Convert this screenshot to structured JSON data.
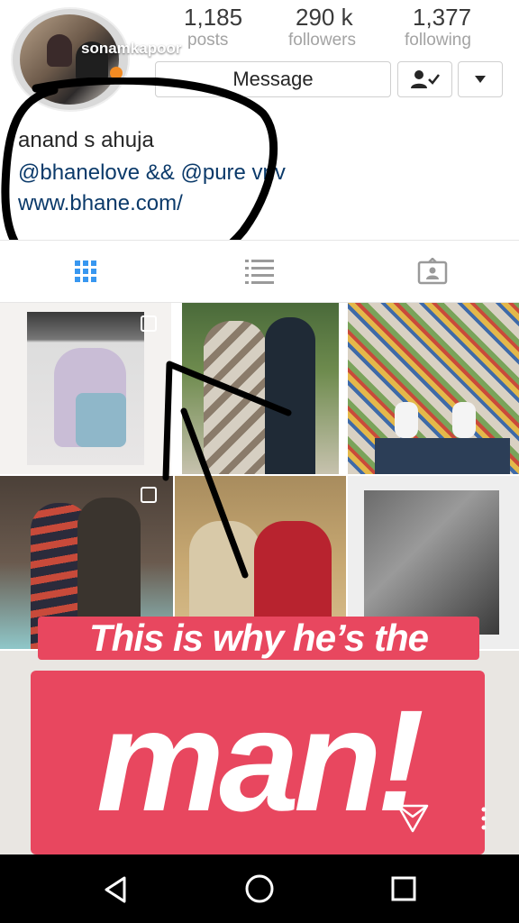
{
  "profile": {
    "username": "sonamkapoor",
    "stats": [
      {
        "value": "1,185",
        "label": "posts"
      },
      {
        "value": "290 k",
        "label": "followers"
      },
      {
        "value": "1,377",
        "label": "following"
      }
    ],
    "message_label": "Message",
    "bio": {
      "name": "anand s ahuja",
      "line": "@bhanelove && @pure vnv",
      "url": "www.bhane.com/"
    }
  },
  "sticker": {
    "line1": "This is why he’s the",
    "line2": "man!"
  },
  "icons": {
    "grid_tab": "grid-icon",
    "list_tab": "list-icon",
    "tagged_tab": "tagged-icon",
    "follow_button": "person-check-icon",
    "dropdown": "chevron-down-icon",
    "send": "send-icon",
    "more": "more-vertical-icon",
    "nav_back": "back-triangle-icon",
    "nav_home": "home-circle-icon",
    "nav_recents": "recents-square-icon"
  },
  "colors": {
    "link": "#0b3a6a",
    "sticker": "#e8475f",
    "active_tab": "#3897f0"
  }
}
